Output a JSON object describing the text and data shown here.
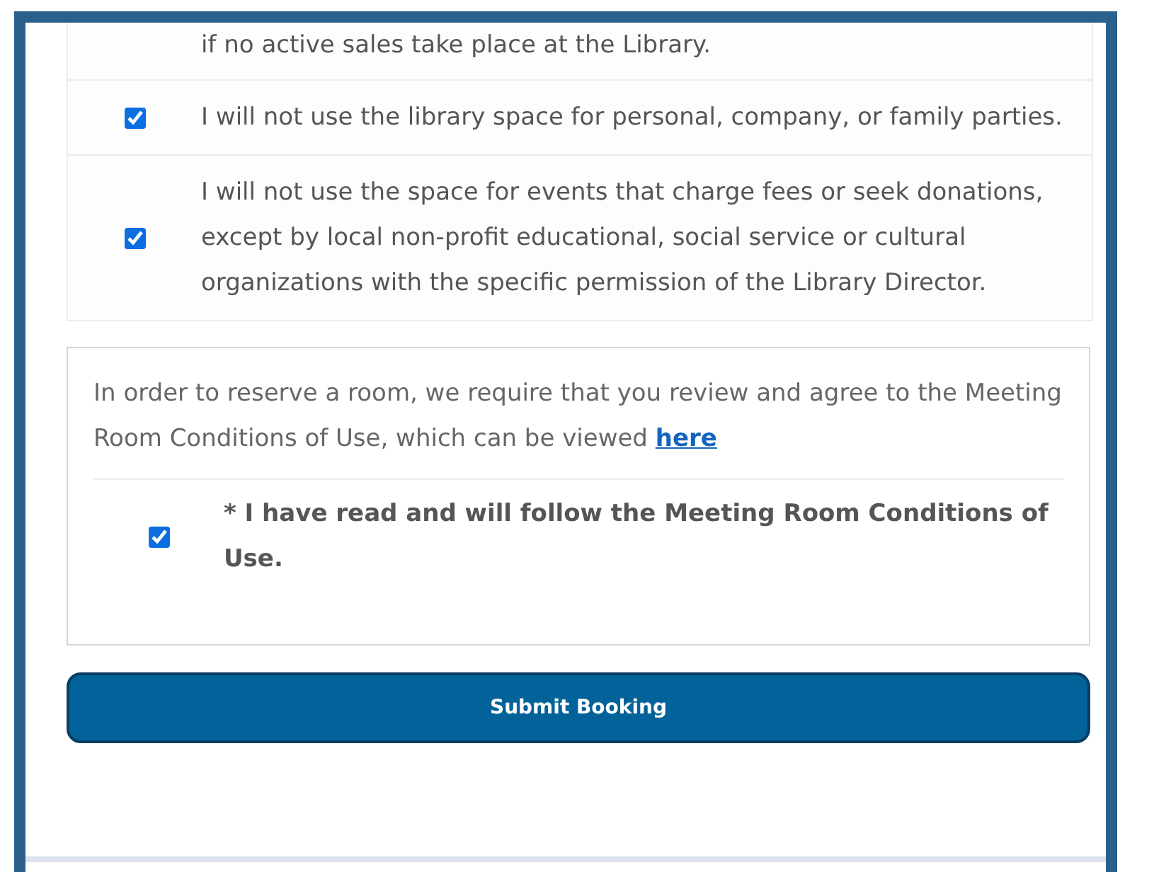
{
  "cut_row_text": "if no active sales take place at the Library.",
  "rules": [
    {
      "text": "I will not use the library space for personal, company, or family parties.",
      "checked": true
    },
    {
      "text": "I will not use the space for events that charge fees or seek donations, except by local non-profit educational, social service or cultural organizations with the specific permission of the Library Director.",
      "checked": true
    }
  ],
  "conditions": {
    "intro": "In order to reserve a room, we require that you review and agree to the Meeting Room Conditions of Use, which can be viewed",
    "link": "here",
    "agree_text": "* I have read and will follow the Meeting Room Conditions of Use.",
    "agree_checked": true
  },
  "submit_button": "Submit Booking"
}
